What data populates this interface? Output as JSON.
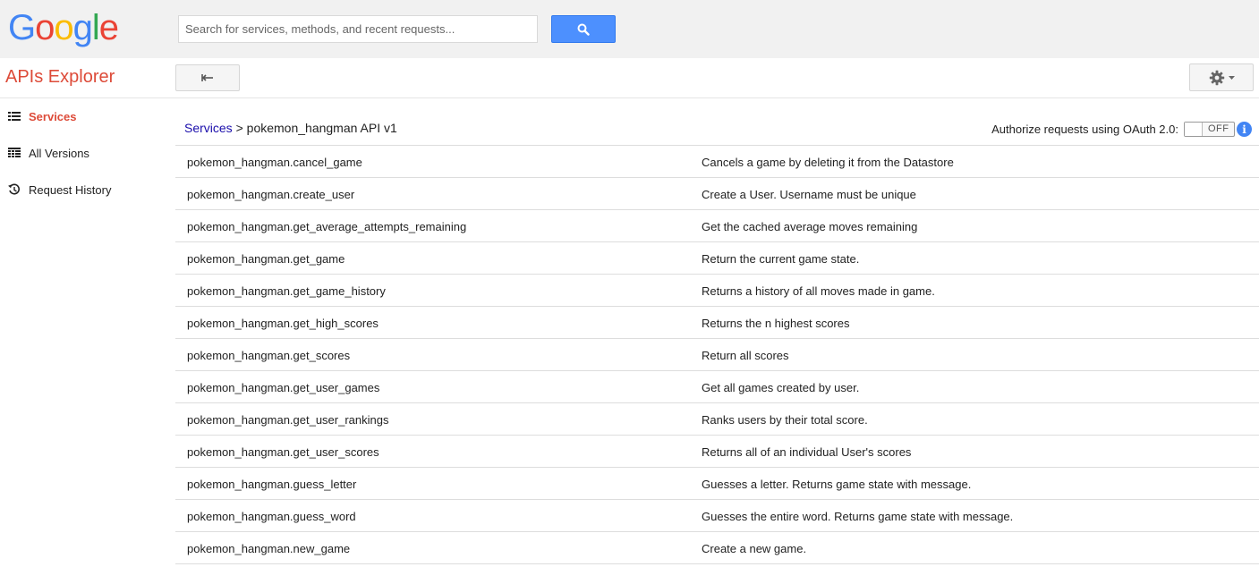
{
  "header": {
    "logo_letters": [
      {
        "ch": "G",
        "color": "#4285f4"
      },
      {
        "ch": "o",
        "color": "#ea4335"
      },
      {
        "ch": "o",
        "color": "#fbbc05"
      },
      {
        "ch": "g",
        "color": "#4285f4"
      },
      {
        "ch": "l",
        "color": "#34a853"
      },
      {
        "ch": "e",
        "color": "#ea4335"
      }
    ],
    "search_placeholder": "Search for services, methods, and recent requests...",
    "search_icon": "search-icon"
  },
  "subbar": {
    "title": "APIs Explorer",
    "back_icon": "back-arrow-icon",
    "settings_icon": "gear-icon"
  },
  "sidebar": {
    "items": [
      {
        "label": "Services",
        "icon": "list-icon",
        "active": true
      },
      {
        "label": "All Versions",
        "icon": "versions-icon",
        "active": false
      },
      {
        "label": "Request History",
        "icon": "history-icon",
        "active": false
      }
    ]
  },
  "breadcrumb": {
    "link": "Services",
    "separator": ">",
    "current": "pokemon_hangman API v1"
  },
  "oauth": {
    "label": "Authorize requests using OAuth 2.0:",
    "toggle_text": "OFF",
    "info_glyph": "i"
  },
  "methods": [
    {
      "name": "pokemon_hangman.cancel_game",
      "description": "Cancels a game by deleting it from the Datastore"
    },
    {
      "name": "pokemon_hangman.create_user",
      "description": "Create a User. Username must be unique"
    },
    {
      "name": "pokemon_hangman.get_average_attempts_remaining",
      "description": "Get the cached average moves remaining"
    },
    {
      "name": "pokemon_hangman.get_game",
      "description": "Return the current game state."
    },
    {
      "name": "pokemon_hangman.get_game_history",
      "description": "Returns a history of all moves made in game."
    },
    {
      "name": "pokemon_hangman.get_high_scores",
      "description": "Returns the n highest scores"
    },
    {
      "name": "pokemon_hangman.get_scores",
      "description": "Return all scores"
    },
    {
      "name": "pokemon_hangman.get_user_games",
      "description": "Get all games created by user."
    },
    {
      "name": "pokemon_hangman.get_user_rankings",
      "description": "Ranks users by their total score."
    },
    {
      "name": "pokemon_hangman.get_user_scores",
      "description": "Returns all of an individual User's scores"
    },
    {
      "name": "pokemon_hangman.guess_letter",
      "description": "Guesses a letter. Returns game state with message."
    },
    {
      "name": "pokemon_hangman.guess_word",
      "description": "Guesses the entire word. Returns game state with message."
    },
    {
      "name": "pokemon_hangman.new_game",
      "description": "Create a new game."
    }
  ]
}
